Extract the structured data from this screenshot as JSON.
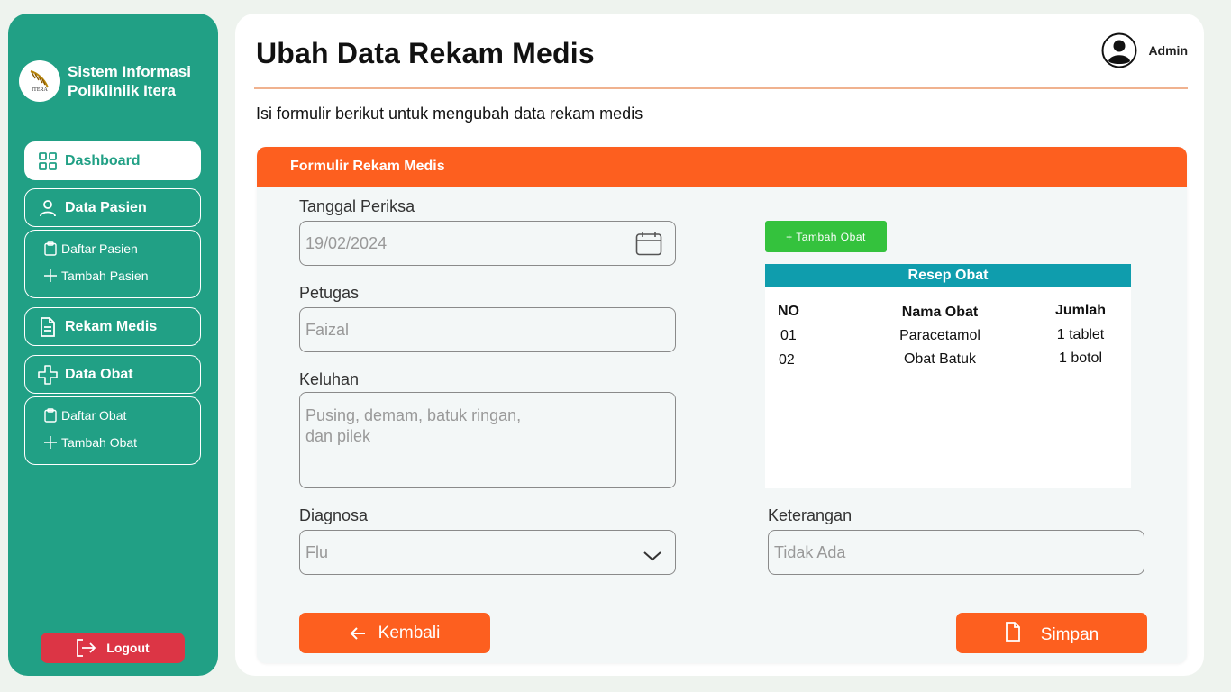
{
  "sidebar": {
    "brand_title": "Sistem Informasi Polikliniik Itera",
    "logo_text": "ITERA",
    "nav": {
      "dashboard": "Dashboard",
      "data_pasien": "Data Pasien",
      "daftar_pasien": "Daftar Pasien",
      "tambah_pasien": "Tambah Pasien",
      "rekam_medis": "Rekam Medis",
      "data_obat": "Data Obat",
      "daftar_obat": "Daftar Obat",
      "tambah_obat": "Tambah Obat"
    },
    "logout": "Logout"
  },
  "header": {
    "title": "Ubah Data Rekam Medis",
    "user": "Admin",
    "subtitle": "Isi formulir berikut untuk mengubah data rekam medis"
  },
  "form": {
    "header": "Formulir Rekam Medis",
    "tanggal": {
      "label": "Tanggal Periksa",
      "value": "19/02/2024"
    },
    "petugas": {
      "label": "Petugas",
      "value": "Faizal"
    },
    "keluhan": {
      "label": "Keluhan",
      "value": "Pusing, demam, batuk ringan,\ndan pilek"
    },
    "diagnosa": {
      "label": "Diagnosa",
      "value": "Flu"
    },
    "keterangan": {
      "label": "Keterangan",
      "value": "Tidak Ada"
    },
    "add_obat": "+ Tambah  Obat",
    "resep": {
      "title": "Resep Obat",
      "columns": [
        "NO",
        "Nama Obat",
        "Jumlah"
      ],
      "rows": [
        [
          "01",
          "Paracetamol",
          "1 tablet"
        ],
        [
          "02",
          "Obat Batuk",
          "1 botol"
        ]
      ]
    },
    "kembali": "Kembali",
    "simpan": "Simpan"
  },
  "colors": {
    "sidebar": "#21a085",
    "accent": "#fd5f1f",
    "table_head": "#0f9dad",
    "add_button": "#34c23d",
    "logout": "#dc3545"
  }
}
